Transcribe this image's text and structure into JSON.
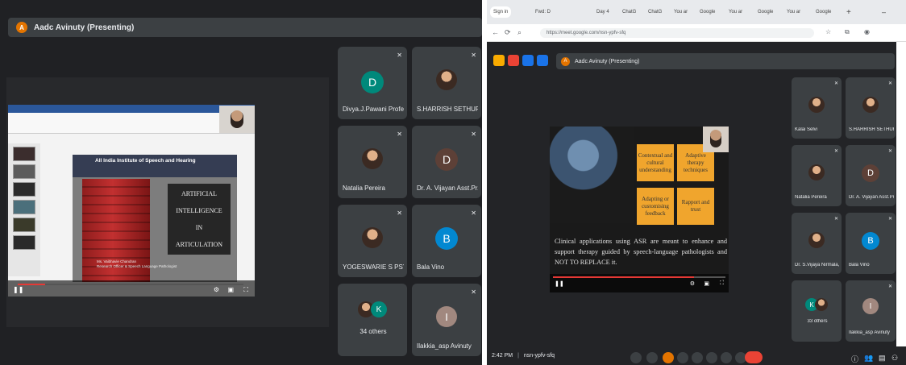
{
  "left": {
    "presenter": "Aadc Avinuty (Presenting)",
    "presenter_initial": "A",
    "slide": {
      "institute": "All India Institute of Speech and Hearing",
      "title_lines": [
        "ARTIFICIAL",
        "INTELLIGENCE",
        "IN",
        "ARTICULATION"
      ],
      "presenter_name": "Ms. Vaibhavie Chandran",
      "presenter_role": "Research Officer & Speech Language Pathologist"
    },
    "video_progress_fraction": 0.12,
    "tiles": [
      {
        "name": "Divya.J.Pawani Profe...",
        "initial": "D",
        "color": "#00897b"
      },
      {
        "name": "S.HARRISH SETHURA..."
      },
      {
        "name": "Natalia Pereira"
      },
      {
        "name": "Dr. A. Vijayan Asst.Pr...",
        "initial": "D",
        "color": "#5d4037"
      },
      {
        "name": "YOGESWARIE S PSY..."
      },
      {
        "name": "Bala Vino",
        "initial": "B",
        "color": "#0288d1"
      },
      {
        "name": "34 others",
        "initial": "K",
        "color": "#00897b"
      },
      {
        "name": "Ilakkia_asp Avinuty",
        "initial": "I",
        "color": "#a1887f"
      }
    ]
  },
  "right": {
    "tabs": [
      "Sign in",
      "Fwd: D",
      "Day 4",
      "ChatG",
      "ChatG",
      "You ar",
      "Google",
      "You ar",
      "Google",
      "You ar",
      "Google"
    ],
    "url": "https://meet.google.com/nsn-ypfv-sfq",
    "presenter": "Aadc Avinuty (Presenting)",
    "presenter_initial": "A",
    "boxes": [
      "Contextual and cultural understanding",
      "Adaptive therapy techniques",
      "Adapting or customising feedback",
      "Rapport and trust"
    ],
    "slide_text": "Clinical applications using ASR are meant to enhance and support therapy guided by speech-language pathologists and NOT TO REPLACE it.",
    "video_progress_fraction": 0.82,
    "tiles": [
      {
        "name": "Kalai Selvi"
      },
      {
        "name": "S.HARRISH SETHURA..."
      },
      {
        "name": "Natalia Pereira"
      },
      {
        "name": "Dr. A. Vijayan Asst.Pr...",
        "initial": "D",
        "color": "#5d4037"
      },
      {
        "name": "Dr. S.Vijaya Nirmala, ..."
      },
      {
        "name": "Bala Vino",
        "initial": "B",
        "color": "#0288d1"
      },
      {
        "name": "33 others",
        "initial": "K",
        "color": "#00897b"
      },
      {
        "name": "Ilakkia_asp Avinuty",
        "initial": "I",
        "color": "#a1887f"
      }
    ],
    "clock": "2:42 PM",
    "meeting_code": "nsn-ypfv-sfq"
  }
}
